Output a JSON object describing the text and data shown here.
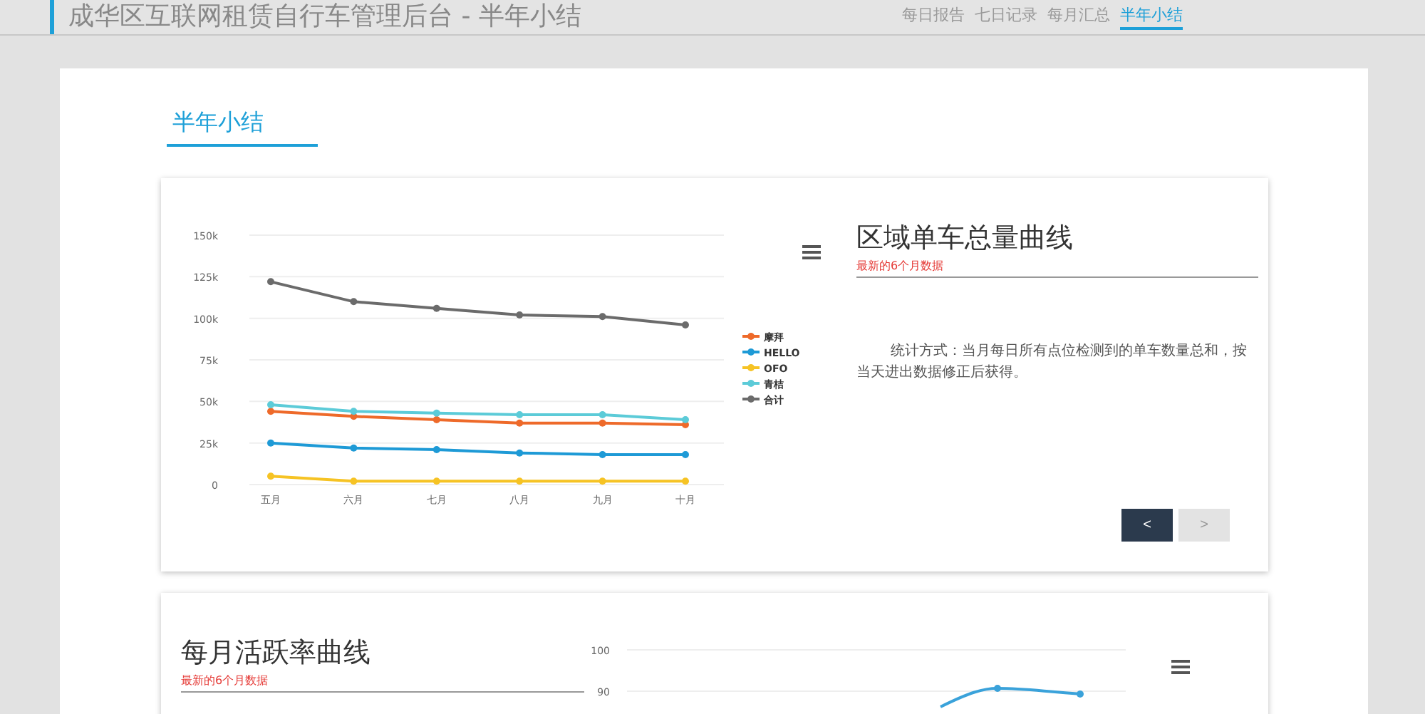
{
  "header": {
    "title": "成华区互联网租赁自行车管理后台 - 半年小结"
  },
  "nav": [
    {
      "label": "每日报告",
      "selected": false
    },
    {
      "label": "七日记录",
      "selected": false
    },
    {
      "label": "每月汇总",
      "selected": false
    },
    {
      "label": "半年小结",
      "selected": true
    }
  ],
  "section_title": "半年小结",
  "cards": [
    {
      "kind": "chart-left",
      "title": "区域单车总量曲线",
      "subtitle": "最新的6个月数据",
      "description": "统计方式：当月每日所有点位检测到的单车数量总和，按当天进出数据修正后获得。",
      "buttons": [
        {
          "label": "<",
          "disabled": false
        },
        {
          "label": ">",
          "disabled": true
        }
      ],
      "chart_data": {
        "type": "line",
        "grid": true,
        "legend": true,
        "categories": [
          "五月",
          "六月",
          "七月",
          "八月",
          "九月",
          "十月"
        ],
        "ylim": [
          0,
          150000
        ],
        "yticks": [
          {
            "value": 0,
            "label": "0"
          },
          {
            "value": 25000,
            "label": "25k"
          },
          {
            "value": 50000,
            "label": "50k"
          },
          {
            "value": 75000,
            "label": "75k"
          },
          {
            "value": 100000,
            "label": "100k"
          },
          {
            "value": 125000,
            "label": "125k"
          },
          {
            "value": 150000,
            "label": "150k"
          }
        ],
        "series": [
          {
            "name": "摩拜",
            "color": "#ee6a2a",
            "marker": "circle",
            "values": [
              44000,
              41000,
              39000,
              37000,
              37000,
              36000
            ]
          },
          {
            "name": "HELLO",
            "color": "#1e9ad6",
            "marker": "circle",
            "values": [
              25000,
              22000,
              21000,
              19000,
              18000,
              18000
            ]
          },
          {
            "name": "OFO",
            "color": "#f6c324",
            "marker": "circle",
            "values": [
              5000,
              2000,
              2000,
              2000,
              2000,
              2000
            ]
          },
          {
            "name": "青桔",
            "color": "#5ccbd8",
            "marker": "circle",
            "values": [
              48000,
              44000,
              43000,
              42000,
              42000,
              39000
            ]
          },
          {
            "name": "合计",
            "color": "#6b6b6b",
            "marker": "circle",
            "values": [
              122000,
              110000,
              106000,
              102000,
              101000,
              96000
            ]
          }
        ]
      }
    },
    {
      "kind": "chart-right",
      "title": "每月活跃率曲线",
      "subtitle": "最新的6个月数据",
      "axis_labels": [
        "100",
        "90"
      ]
    }
  ]
}
